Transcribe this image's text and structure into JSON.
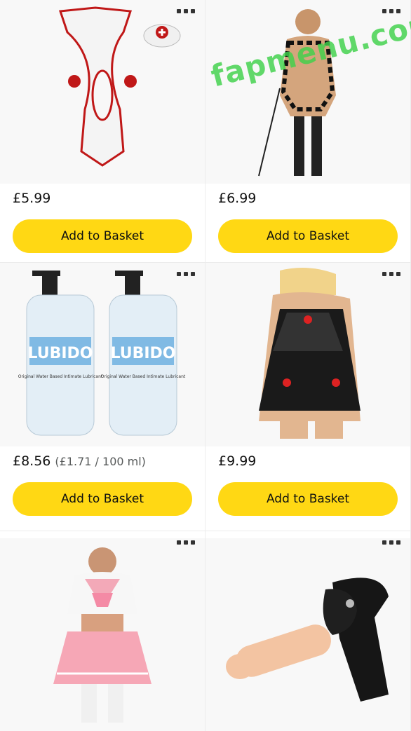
{
  "products": [
    {
      "price": "£5.99",
      "unit_price": "",
      "button_label": "Add to Basket",
      "image_icon": "nurse-costume-icon"
    },
    {
      "price": "£6.99",
      "unit_price": "",
      "button_label": "Add to Basket",
      "image_icon": "lingerie-bodysuit-icon"
    },
    {
      "price": "£8.56",
      "unit_price": "(£1.71 / 100 ml)",
      "button_label": "Add to Basket",
      "image_icon": "lubricant-bottles-icon",
      "bottle_brand": "LUBIDO",
      "bottle_text": "Original Water Based Intimate Lubricant"
    },
    {
      "price": "£9.99",
      "unit_price": "",
      "button_label": "Add to Basket",
      "image_icon": "lace-babydoll-icon"
    },
    {
      "price": "",
      "unit_price": "",
      "button_label": "",
      "image_icon": "schoolgirl-costume-icon"
    },
    {
      "price": "",
      "unit_price": "",
      "button_label": "",
      "image_icon": "strap-on-harness-icon"
    }
  ],
  "watermark": "fapmenu.com",
  "colors": {
    "button": "#ffd814",
    "image_bg": "#f8f8f8",
    "watermark": "#3fd14a"
  }
}
